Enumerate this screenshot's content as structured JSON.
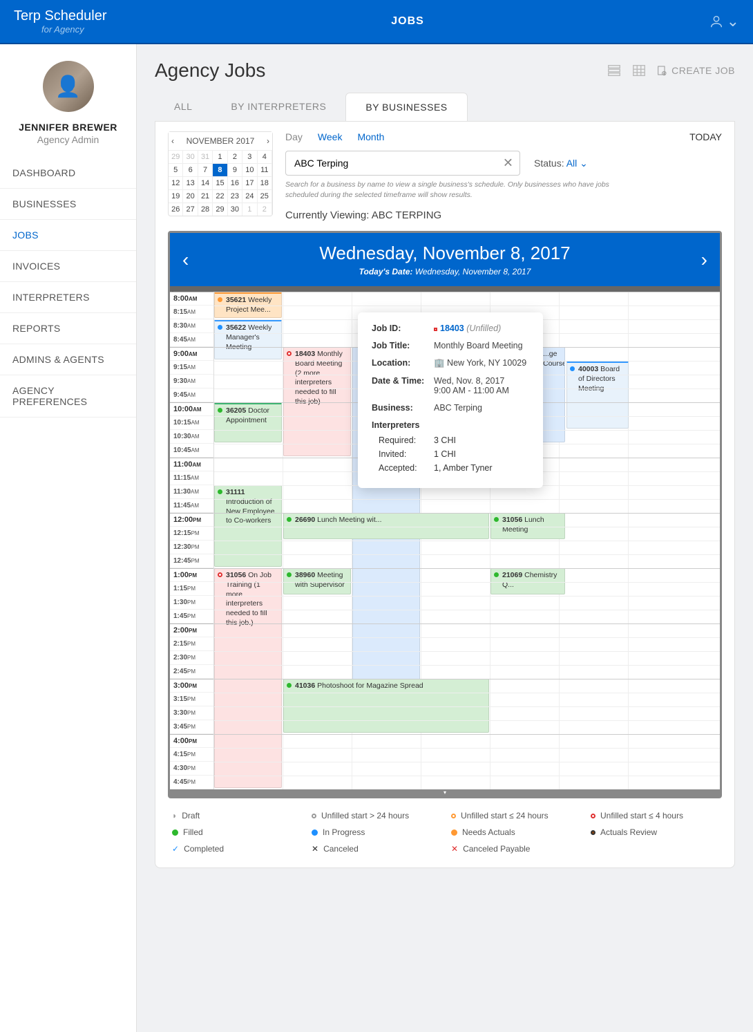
{
  "app": {
    "name": "Terp Scheduler",
    "sub": "for Agency",
    "topTitle": "JOBS"
  },
  "user": {
    "name": "JENNIFER BREWER",
    "role": "Agency Admin"
  },
  "nav": {
    "items": [
      "DASHBOARD",
      "BUSINESSES",
      "JOBS",
      "INVOICES",
      "INTERPRETERS",
      "REPORTS",
      "ADMINS & AGENTS",
      "AGENCY PREFERENCES"
    ],
    "activeIndex": 2
  },
  "page": {
    "title": "Agency Jobs",
    "createLabel": "CREATE JOB"
  },
  "tabs": {
    "items": [
      "ALL",
      "BY INTERPRETERS",
      "BY BUSINESSES"
    ],
    "activeIndex": 2
  },
  "miniCal": {
    "label": "NOVEMBER 2017",
    "days": [
      "29",
      "30",
      "31",
      "1",
      "2",
      "3",
      "4",
      "5",
      "6",
      "7",
      "8",
      "9",
      "10",
      "11",
      "12",
      "13",
      "14",
      "15",
      "16",
      "17",
      "18",
      "19",
      "20",
      "21",
      "22",
      "23",
      "24",
      "25",
      "26",
      "27",
      "28",
      "29",
      "30",
      "1",
      "2"
    ],
    "otherStart": 0,
    "otherEndCount": 2,
    "selectedIndex": 10
  },
  "viewToggle": {
    "day": "Day",
    "week": "Week",
    "month": "Month",
    "today": "TODAY"
  },
  "search": {
    "value": "ABC Terping",
    "hint": "Search for a business by name to view a single business's schedule. Only businesses who have jobs scheduled during the selected timeframe will show results."
  },
  "statusFilter": {
    "label": "Status:",
    "value": "All"
  },
  "currently": {
    "label": "Currently Viewing: ",
    "value": "ABC TERPING"
  },
  "calHead": {
    "date": "Wednesday, November 8, 2017",
    "todayLabel": "Today's Date:",
    "todayVal": "Wednesday, November 8, 2017"
  },
  "timeLabels": [
    "8:00 AM",
    "8:15 AM",
    "8:30 AM",
    "8:45 AM",
    "9:00 AM",
    "9:15 AM",
    "9:30 AM",
    "9:45 AM",
    "10:00 AM",
    "10:15 AM",
    "10:30 AM",
    "10:45 AM",
    "11:00 AM",
    "11:15 AM",
    "11:30 AM",
    "11:45 AM",
    "12:00 PM",
    "12:15 PM",
    "12:30 PM",
    "12:45 PM",
    "1:00 PM",
    "1:15 PM",
    "1:30 PM",
    "1:45 PM",
    "2:00 PM",
    "2:15 PM",
    "2:30 PM",
    "2:45 PM",
    "3:00 PM",
    "3:15 PM",
    "3:30 PM",
    "3:45 PM",
    "4:00 PM",
    "4:15 PM",
    "4:30 PM",
    "4:45 PM"
  ],
  "events": {
    "e1": {
      "id": "35621",
      "title": "Weekly Project Mee..."
    },
    "e2": {
      "id": "35622",
      "title": "Weekly Manager's Meeting"
    },
    "e3": {
      "id": "18403",
      "title": "Monthly Board Meeting (2 more interpreters needed to fill this job)"
    },
    "e4": {
      "id": "36205",
      "title": "Doctor Appointment"
    },
    "e5": {
      "id": "31111",
      "title": "Introduction of New Employee to Co-workers"
    },
    "e6": {
      "id": "26690",
      "title": "Lunch Meeting wit..."
    },
    "e7": {
      "id": "31056 L",
      "title": "Lunch Meeting"
    },
    "e8": {
      "id": "31056 O",
      "title": "On Job Training (1 more interpreters needed to fill this job.)"
    },
    "e9": {
      "id": "38960",
      "title": "Meeting with Supervisor"
    },
    "e10": {
      "id": "21069",
      "title": "Chemistry Q..."
    },
    "e11": {
      "id": "41036",
      "title": "Photoshoot for Magazine Spread"
    },
    "e12": {
      "id": "40003",
      "title": "Board of Directors Meeting"
    },
    "e13": {
      "title": "...ge Course"
    }
  },
  "popover": {
    "jobIdLabel": "Job ID:",
    "jobId": "18403",
    "jobStatus": "(Unfilled)",
    "titleLabel": "Job Title:",
    "title": "Monthly Board Meeting",
    "locationLabel": "Location:",
    "location": "New York, NY 10029",
    "dateLabel": "Date & Time:",
    "dateVal1": "Wed, Nov. 8, 2017",
    "dateVal2": "9:00 AM - 11:00 AM",
    "businessLabel": "Business:",
    "business": "ABC Terping",
    "interpHeader": "Interpreters",
    "requiredLabel": "Required:",
    "required": "3 CHI",
    "invitedLabel": "Invited:",
    "invited": "1 CHI",
    "acceptedLabel": "Accepted:",
    "accepted": "1, Amber Tyner"
  },
  "legend": {
    "draft": "Draft",
    "unfilled24p": "Unfilled start > 24 hours",
    "unfilled24": "Unfilled start ≤ 24 hours",
    "unfilled4": "Unfilled start ≤ 4 hours",
    "filled": "Filled",
    "inprogress": "In Progress",
    "needsActuals": "Needs Actuals",
    "actualsReview": "Actuals Review",
    "completed": "Completed",
    "canceled": "Canceled",
    "canceledPayable": "Canceled Payable"
  }
}
